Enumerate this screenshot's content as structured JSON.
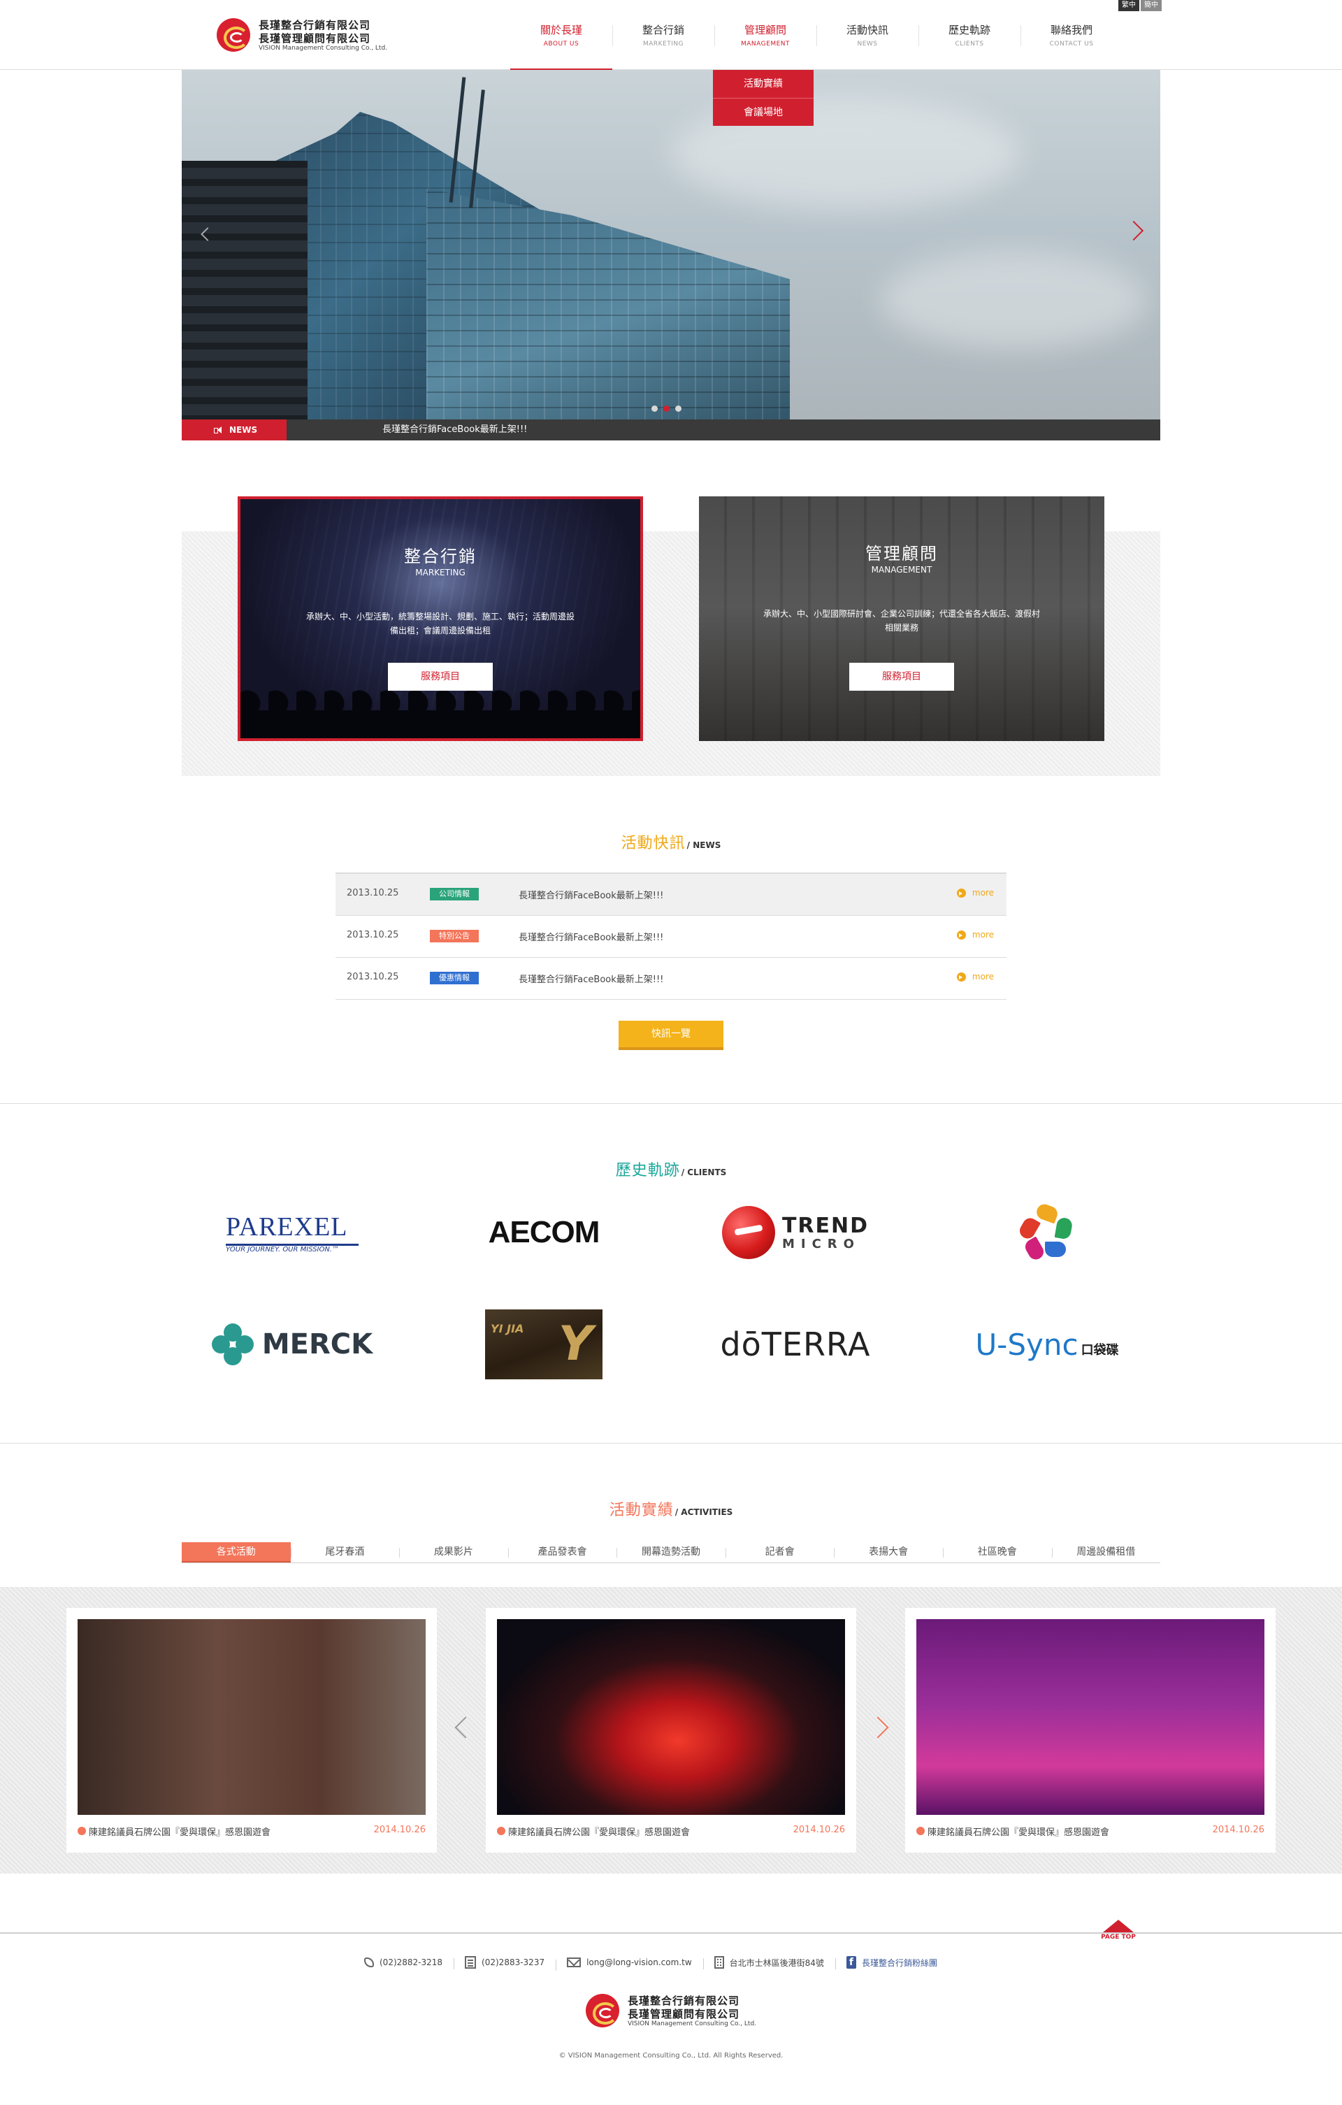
{
  "brand": {
    "name_line1": "長瑾整合行銷有限公司",
    "name_line2": "長瑾管理顧問有限公司",
    "name_en": "VISION Management Consulting Co., Ltd.",
    "accent": "#d0202f"
  },
  "lang": {
    "traditional": "繁中",
    "simplified": "簡中"
  },
  "nav": [
    {
      "zh": "關於長瑾",
      "en": "ABOUT US"
    },
    {
      "zh": "整合行銷",
      "en": "MARKETING"
    },
    {
      "zh": "管理顧問",
      "en": "MANAGEMENT"
    },
    {
      "zh": "活動快訊",
      "en": "NEWS"
    },
    {
      "zh": "歷史軌跡",
      "en": "CLIENTS"
    },
    {
      "zh": "聯絡我們",
      "en": "CONTACT US"
    }
  ],
  "dropdown": [
    "活動實績",
    "會議場地"
  ],
  "hero": {
    "news_label": "NEWS",
    "news_text": "長瑾整合行銷FaceBook最新上架!!!",
    "slides": 3,
    "current_slide": 2
  },
  "services": [
    {
      "title": "整合行銷",
      "subtitle": "MARKETING",
      "desc": "承辦大、中、小型活動，統籌整場設計、規劃、施工、執行；活動周邊設備出租；會議周邊設備出租",
      "button": "服務項目"
    },
    {
      "title": "管理顧問",
      "subtitle": "MANAGEMENT",
      "desc": "承辦大、中、小型國際研討會、企業公司訓練；代還全省各大飯店、渡假村相關業務",
      "button": "服務項目"
    }
  ],
  "news": {
    "title_zh": "活動快訊",
    "title_en": "/ NEWS",
    "title_color": "#f0a818",
    "items": [
      {
        "date": "2013.10.25",
        "tag": "公司情報",
        "tag_color": "#2aa37a",
        "title": "長瑾整合行銷FaceBook最新上架!!!",
        "more": "more"
      },
      {
        "date": "2013.10.25",
        "tag": "特別公告",
        "tag_color": "#f3755a",
        "title": "長瑾整合行銷FaceBook最新上架!!!",
        "more": "more"
      },
      {
        "date": "2013.10.25",
        "tag": "優惠情報",
        "tag_color": "#2f6fd0",
        "title": "長瑾整合行銷FaceBook最新上架!!!",
        "more": "more"
      }
    ],
    "all_button": "快訊一覽"
  },
  "clients": {
    "title_zh": "歷史軌跡",
    "title_en": "/ CLIENTS",
    "title_color": "#1aa79a",
    "logos": {
      "parexel": {
        "name": "PAREXEL",
        "tagline": "YOUR JOURNEY. OUR MISSION.™"
      },
      "aecom": {
        "name": "AECOM"
      },
      "trend": {
        "line1": "TREND",
        "line2": "MICRO"
      },
      "merck": {
        "name": "MERCK"
      },
      "yijia": {
        "latin": "YI JIA",
        "mark": "Y"
      },
      "doterra": {
        "name": "dōTERRA"
      },
      "usync": {
        "name": "U-Sync",
        "sub": "口袋碟"
      }
    }
  },
  "activities": {
    "title_zh": "活動實績",
    "title_en": "/ ACTIVITIES",
    "title_color": "#f3755a",
    "tabs": [
      "各式活動",
      "尾牙春酒",
      "成果影片",
      "產品發表會",
      "開幕造勢活動",
      "記者會",
      "表揚大會",
      "社區晚會",
      "周邊設備租借"
    ],
    "cards": [
      {
        "caption": "陳建銘議員石牌公園『愛與環保』感恩園遊會",
        "date": "2014.10.26"
      },
      {
        "caption": "陳建銘議員石牌公園『愛與環保』感恩園遊會",
        "date": "2014.10.26"
      },
      {
        "caption": "陳建銘議員石牌公園『愛與環保』感恩園遊會",
        "date": "2014.10.26"
      }
    ]
  },
  "footer": {
    "page_top": "PAGE TOP",
    "phone": "(02)2882-3218",
    "fax": "(02)2883-3237",
    "email": "long@long-vision.com.tw",
    "address": "台北市士林區後港街84號",
    "facebook": "長瑾整合行銷粉絲團",
    "copyright": "© VISION Management Consulting Co., Ltd. All Rights Reserved."
  }
}
